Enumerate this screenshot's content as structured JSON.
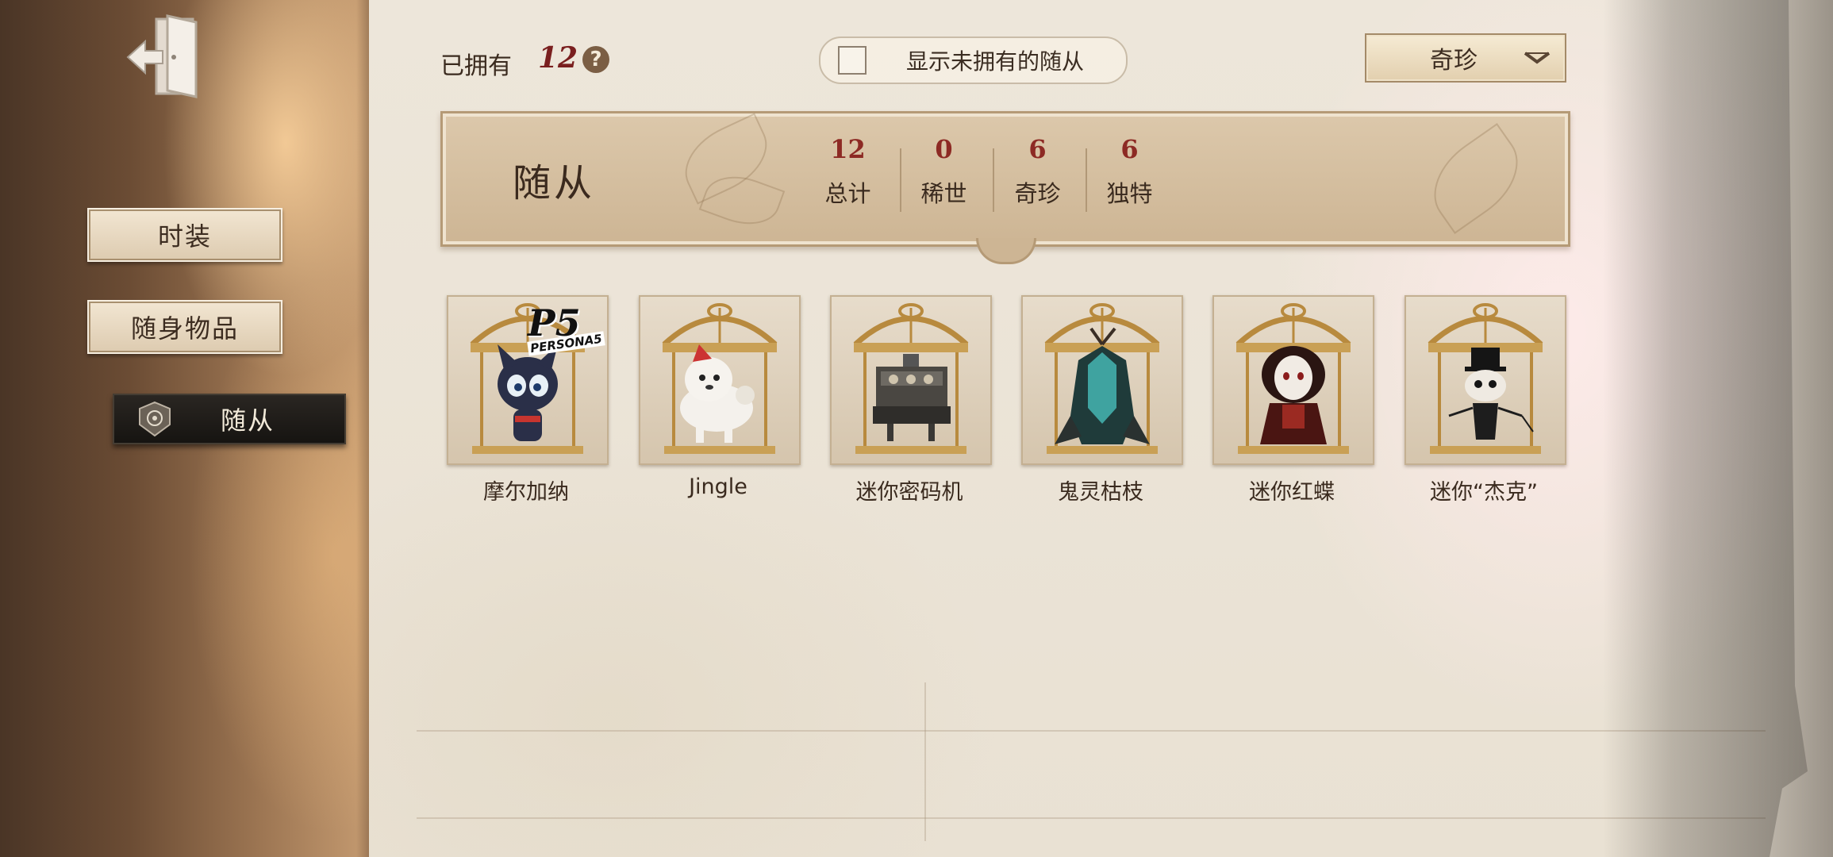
{
  "sidebar": {
    "items": [
      {
        "label": "时装"
      },
      {
        "label": "随身物品"
      },
      {
        "label": "随从"
      }
    ]
  },
  "topbar": {
    "owned_label": "已拥有",
    "owned_count": "12",
    "help_symbol": "?",
    "toggle_label": "显示未拥有的随从",
    "toggle_checked": false,
    "filter_value": "奇珍"
  },
  "banner": {
    "title": "随从",
    "stats": [
      {
        "value": "12",
        "label": "总计"
      },
      {
        "value": "0",
        "label": "稀世"
      },
      {
        "value": "6",
        "label": "奇珍"
      },
      {
        "value": "6",
        "label": "独特"
      }
    ]
  },
  "items": [
    {
      "name": "摩尔加纳",
      "logo": "P5",
      "logo_sub": "PERSONA5"
    },
    {
      "name": "Jingle"
    },
    {
      "name": "迷你密码机"
    },
    {
      "name": "鬼灵枯枝"
    },
    {
      "name": "迷你红蝶"
    },
    {
      "name": "迷你“杰克”"
    }
  ],
  "colors": {
    "accent_red": "#8d2a24",
    "active_tab": "#1c1915",
    "banner": "#d6c2a2",
    "gold": "#b88a3e"
  },
  "icons": [
    "exit-door-icon",
    "help-icon",
    "checkbox",
    "chevron-down-icon",
    "companion-badge-icon",
    "birdcage-icon"
  ]
}
